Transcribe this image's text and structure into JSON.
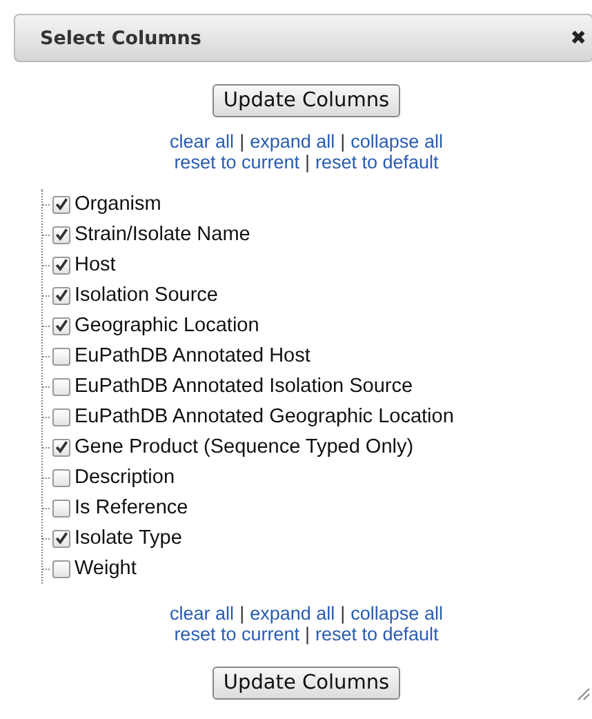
{
  "dialog": {
    "title": "Select Columns",
    "close": "✖"
  },
  "top_button": "Update Columns",
  "top_links": [
    {
      "items": [
        "clear all",
        "expand all",
        "collapse all"
      ]
    },
    {
      "items": [
        "reset to current",
        "reset to default"
      ]
    }
  ],
  "separator": "|",
  "columns": [
    {
      "label": "Organism",
      "checked": true
    },
    {
      "label": "Strain/Isolate Name",
      "checked": true
    },
    {
      "label": "Host",
      "checked": true
    },
    {
      "label": "Isolation Source",
      "checked": true
    },
    {
      "label": "Geographic Location",
      "checked": true
    },
    {
      "label": "EuPathDB Annotated Host",
      "checked": false
    },
    {
      "label": "EuPathDB Annotated Isolation Source",
      "checked": false
    },
    {
      "label": "EuPathDB Annotated Geographic Location",
      "checked": false
    },
    {
      "label": "Gene Product (Sequence Typed Only)",
      "checked": true
    },
    {
      "label": "Description",
      "checked": false
    },
    {
      "label": "Is Reference",
      "checked": false
    },
    {
      "label": "Isolate Type",
      "checked": true
    },
    {
      "label": "Weight",
      "checked": false
    }
  ],
  "bottom_links": [
    {
      "items": [
        "clear all",
        "expand all",
        "collapse all"
      ]
    },
    {
      "items": [
        "reset to current",
        "reset to default"
      ]
    }
  ],
  "bottom_button": "Update Columns"
}
